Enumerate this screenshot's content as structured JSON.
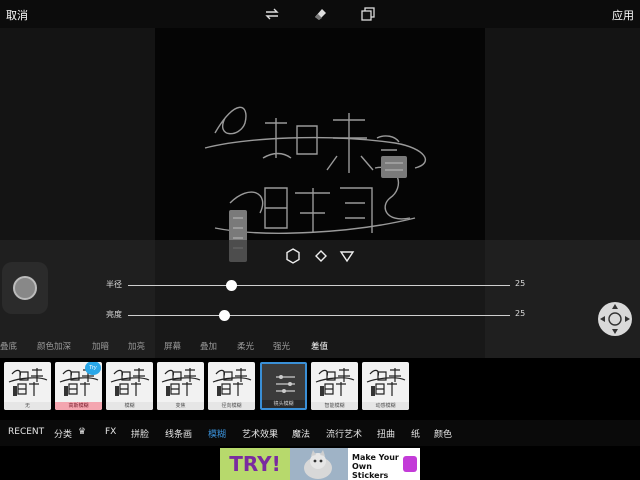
{
  "topbar": {
    "cancel": "取消",
    "apply": "应用",
    "tools": [
      "swap-icon",
      "eraser-icon",
      "layers-icon"
    ]
  },
  "sliders": [
    {
      "label": "半径",
      "value": "25",
      "level": 0.27
    },
    {
      "label": "亮度",
      "value": "25",
      "level": 0.25
    }
  ],
  "shapes": [
    "circle-shape-icon",
    "diamond-shape-icon",
    "triangle-shape-icon"
  ],
  "blend_modes": [
    {
      "label": "叠底",
      "active": false
    },
    {
      "label": "颜色加深",
      "active": false
    },
    {
      "label": "加暗",
      "active": false
    },
    {
      "label": "加亮",
      "active": false
    },
    {
      "label": "屏幕",
      "active": false
    },
    {
      "label": "叠加",
      "active": false
    },
    {
      "label": "柔光",
      "active": false
    },
    {
      "label": "强光",
      "active": false
    },
    {
      "label": "差值",
      "active": true
    }
  ],
  "effects": [
    {
      "caption": "无",
      "selected": false,
      "badge": ""
    },
    {
      "caption": "高斯模糊",
      "selected": false,
      "badge": "Try"
    },
    {
      "caption": "模糊",
      "selected": false,
      "badge": ""
    },
    {
      "caption": "变焦",
      "selected": false,
      "badge": ""
    },
    {
      "caption": "径向模糊",
      "selected": false,
      "badge": ""
    },
    {
      "caption": "镜头模糊",
      "selected": true,
      "badge": ""
    },
    {
      "caption": "智能模糊",
      "selected": false,
      "badge": ""
    },
    {
      "caption": "动感模糊",
      "selected": false,
      "badge": ""
    }
  ],
  "categories": [
    {
      "label": "RECENT",
      "active": false
    },
    {
      "label": "分类",
      "active": false
    },
    {
      "label": "FX",
      "active": false
    },
    {
      "label": "拼脸",
      "active": false
    },
    {
      "label": "线条画",
      "active": false
    },
    {
      "label": "模糊",
      "active": true
    },
    {
      "label": "艺术效果",
      "active": false
    },
    {
      "label": "魔法",
      "active": false
    },
    {
      "label": "流行艺术",
      "active": false
    },
    {
      "label": "扭曲",
      "active": false
    },
    {
      "label": "纸",
      "active": false
    },
    {
      "label": "颜色",
      "active": false
    }
  ],
  "ad": {
    "try": "TRY!",
    "line1": "Make Your Own",
    "line2": "Stickers"
  },
  "colors": {
    "accent": "#3a8fd6",
    "badge": "#2aa7e8",
    "crown": "#f5b400"
  }
}
